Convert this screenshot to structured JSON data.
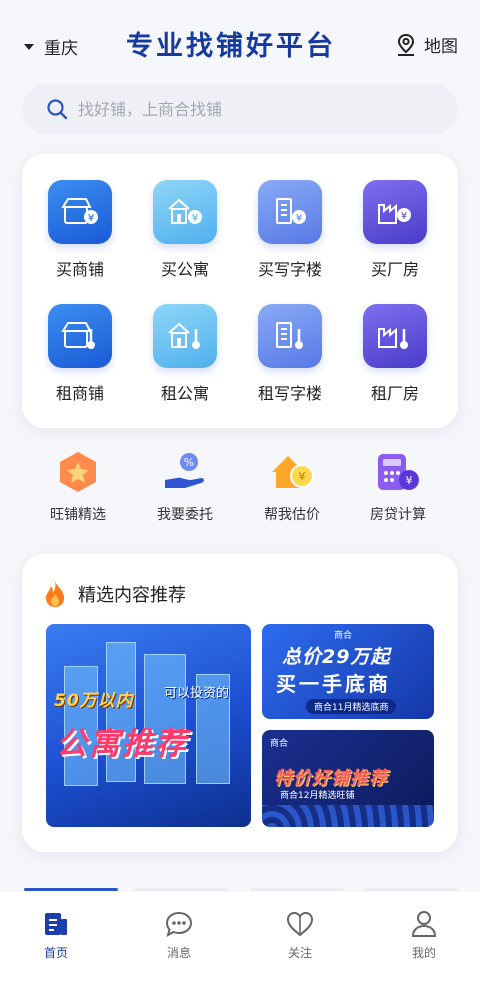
{
  "header": {
    "city": "重庆",
    "slogan": "专业找铺好平台",
    "map_label": "地图"
  },
  "search": {
    "placeholder": "找好铺，上商合找铺"
  },
  "categories": [
    {
      "label": "买商铺",
      "icon": "shop-money-icon",
      "color": "#1a5ad6"
    },
    {
      "label": "买公寓",
      "icon": "apartment-money-icon",
      "color": "#4fb0ee"
    },
    {
      "label": "买写字楼",
      "icon": "office-money-icon",
      "color": "#5779e6"
    },
    {
      "label": "买厂房",
      "icon": "factory-money-icon",
      "color": "#4a3cc8"
    },
    {
      "label": "租商铺",
      "icon": "shop-rent-icon",
      "color": "#1a5ad6"
    },
    {
      "label": "租公寓",
      "icon": "apartment-rent-icon",
      "color": "#4fb0ee"
    },
    {
      "label": "租写字楼",
      "icon": "office-rent-icon",
      "color": "#5779e6"
    },
    {
      "label": "租厂房",
      "icon": "factory-rent-icon",
      "color": "#4a3cc8"
    }
  ],
  "quick_actions": [
    {
      "label": "旺铺精选",
      "icon": "star-badge-icon"
    },
    {
      "label": "我要委托",
      "icon": "hand-percent-icon"
    },
    {
      "label": "帮我估价",
      "icon": "house-coin-icon"
    },
    {
      "label": "房贷计算",
      "icon": "calculator-icon"
    }
  ],
  "recommend": {
    "title": "精选内容推荐",
    "banner_big": {
      "amount": "50万以内",
      "sub": "可以投资的",
      "main": "公寓推荐"
    },
    "banner_small1": {
      "logo": "商合",
      "line1": "总价29万起",
      "line2": "买一手底商",
      "tag": "商合11月精选底商"
    },
    "banner_small2": {
      "top": "商合",
      "main": "特价好铺推荐",
      "tag": "商合12月精选旺铺"
    }
  },
  "tabbar": [
    {
      "label": "首页",
      "icon": "home-doc-icon",
      "active": true
    },
    {
      "label": "消息",
      "icon": "chat-bubble-icon",
      "active": false
    },
    {
      "label": "关注",
      "icon": "heart-icon",
      "active": false
    },
    {
      "label": "我的",
      "icon": "user-icon",
      "active": false
    }
  ],
  "colors": {
    "brand": "#173a9e",
    "accent": "#2b56c9",
    "background": "#f6f7fb"
  }
}
